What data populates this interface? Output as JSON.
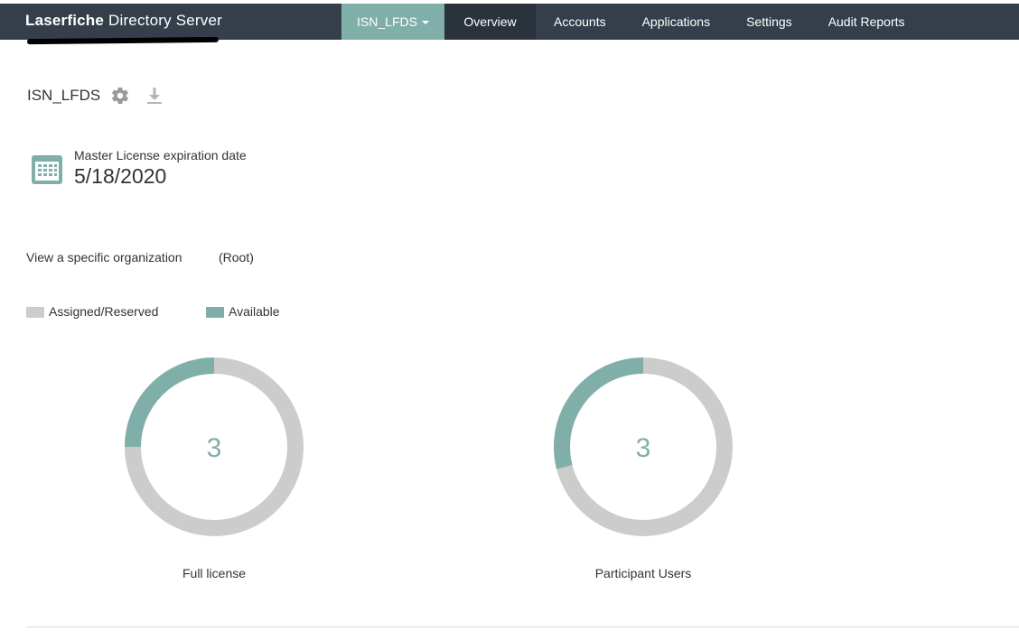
{
  "app": {
    "brand_bold": "Laserfiche",
    "brand_rest": "Directory Server"
  },
  "nav": {
    "org_label": "ISN_LFDS",
    "items": [
      {
        "label": "Overview",
        "active": true
      },
      {
        "label": "Accounts"
      },
      {
        "label": "Applications"
      },
      {
        "label": "Settings"
      },
      {
        "label": "Audit Reports"
      }
    ]
  },
  "server": {
    "name": "ISN_LFDS"
  },
  "license": {
    "label": "Master License expiration date",
    "date": "5/18/2020"
  },
  "organization": {
    "label": "View a specific organization",
    "value": "(Root)"
  },
  "legend": {
    "assigned_label": "Assigned/Reserved",
    "available_label": "Available"
  },
  "colors": {
    "assigned": "#cccccc",
    "available": "#80afa9",
    "topbar": "#353f4b",
    "nav_active": "#2a323c"
  },
  "chart_data": [
    {
      "type": "pie",
      "title": "Full license",
      "center_label": "3",
      "available_fraction": 0.25,
      "assigned_fraction": 0.75
    },
    {
      "type": "pie",
      "title": "Participant Users",
      "center_label": "3",
      "available_fraction": 0.29,
      "assigned_fraction": 0.71
    }
  ],
  "icons": {
    "settings": "gear-icon",
    "download": "download-icon",
    "calendar": "calendar-icon"
  }
}
